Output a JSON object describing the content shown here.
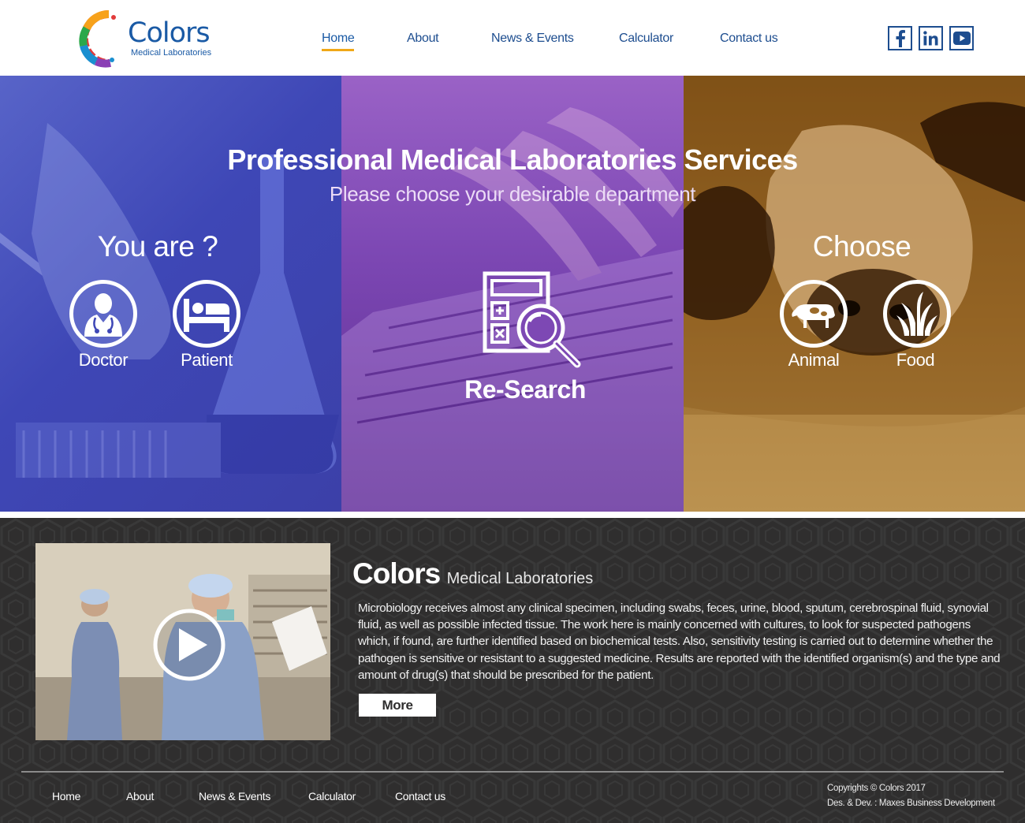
{
  "brand": {
    "name": "Colors",
    "subtitle": "Medical Laboratories"
  },
  "nav": {
    "items": [
      {
        "label": "Home",
        "active": true
      },
      {
        "label": "About"
      },
      {
        "label": "News & Events"
      },
      {
        "label": "Calculator"
      },
      {
        "label": "Contact us"
      }
    ],
    "active_color": "#f0a818"
  },
  "social": [
    {
      "icon": "facebook-icon"
    },
    {
      "icon": "linkedin-icon"
    },
    {
      "icon": "youtube-icon"
    }
  ],
  "hero": {
    "title": "Professional Medical Laboratories Services",
    "subtitle": "Please choose your desirable department",
    "left": {
      "heading": "You are ?",
      "options": [
        {
          "label": "Doctor",
          "icon": "doctor-icon"
        },
        {
          "label": "Patient",
          "icon": "patient-bed-icon"
        }
      ],
      "color": "#3e47b6"
    },
    "middle": {
      "label": "Re-Search",
      "icon": "calculator-search-icon",
      "color": "#7d48b4"
    },
    "right": {
      "heading": "Choose",
      "options": [
        {
          "label": "Animal",
          "icon": "cow-icon"
        },
        {
          "label": "Food",
          "icon": "wheat-icon"
        }
      ],
      "color": "#9a6a2a"
    }
  },
  "about": {
    "title_brand": "Colors",
    "title_rest": "Medical Laboratories",
    "text": "Microbiology receives almost any clinical specimen, including swabs, feces, urine, blood, sputum, cerebrospinal fluid, synovial fluid, as well as possible infected tissue. The work here is mainly concerned with cultures, to look for suspected pathogens which, if found, are further identified based on biochemical tests. Also, sensitivity testing is carried out to determine whether the pathogen is sensitive or resistant to a suggested medicine. Results are reported with the identified organism(s) and the type and amount of drug(s) that should be prescribed for the patient.",
    "more_label": "More",
    "video_icon": "play-icon"
  },
  "footer": {
    "links": [
      "Home",
      "About",
      "News & Events",
      "Calculator",
      "Contact us"
    ],
    "copyright": "Copyrights © Colors 2017",
    "credit": "Des. & Dev. : Maxes Business Development"
  }
}
